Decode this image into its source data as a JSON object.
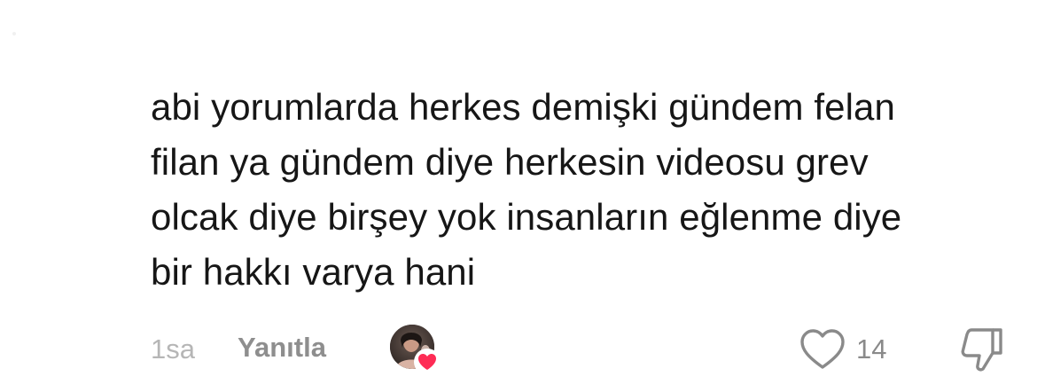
{
  "comment": {
    "text": "abi yorumlarda herkes demişki gündem felan\nfilan ya gündem diye herkesin videosu grev\nolcak diye birşey yok insanların eğlenme diye\nbir hakkı varya hani",
    "timestamp": "1sa",
    "reply_label": "Yanıtla",
    "like_count": "14",
    "creator_liked": true
  },
  "icons": {
    "like": "heart-outline-icon",
    "dislike": "thumbs-down-icon",
    "creator_badge": "heart-filled-icon"
  },
  "colors": {
    "text": "#161616",
    "muted": "#8e8e8e",
    "timestamp": "#b6b6b6",
    "heart_badge": "#fe2c55"
  }
}
